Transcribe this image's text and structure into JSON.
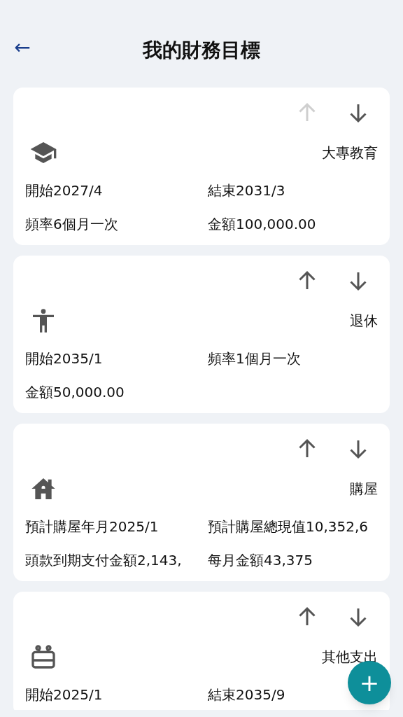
{
  "header": {
    "back": "←",
    "title": "我的財務目標"
  },
  "goals": [
    {
      "kind": "education",
      "title": "大專教育",
      "up_disabled": true,
      "down_disabled": false,
      "details": [
        "開始2027/4",
        "結束2031/3",
        "頻率6個月一次",
        "金額100,000.00"
      ]
    },
    {
      "kind": "retirement",
      "title": "退休",
      "up_disabled": false,
      "down_disabled": false,
      "details": [
        "開始2035/1",
        "頻率1個月一次",
        "金額50,000.00"
      ]
    },
    {
      "kind": "house",
      "title": "購屋",
      "up_disabled": false,
      "down_disabled": false,
      "details": [
        "預計購屋年月2025/1",
        "預計購屋總現值10,352,6",
        "頭款到期支付金額2,143,",
        "每月金額43,375"
      ]
    },
    {
      "kind": "other",
      "title": "其他支出",
      "up_disabled": false,
      "down_disabled": false,
      "details": [
        "開始2025/1",
        "結束2035/9"
      ]
    }
  ],
  "fab": "+"
}
